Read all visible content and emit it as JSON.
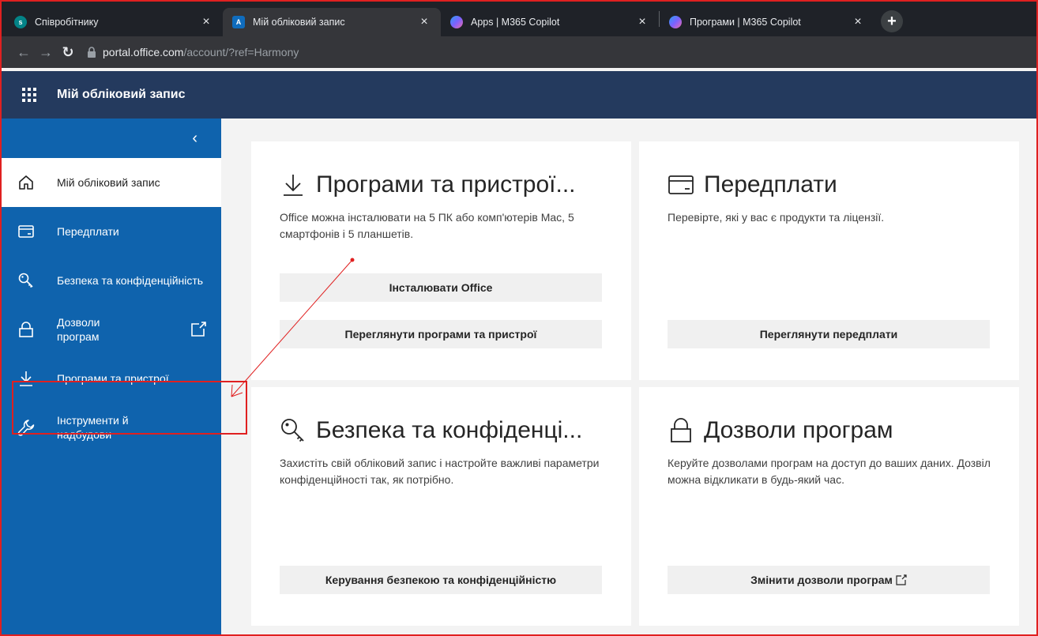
{
  "browser": {
    "tabs": [
      {
        "title": "Співробітнику",
        "favicon_color": "#038387",
        "favicon_text": "s",
        "active": false
      },
      {
        "title": "Мій обліковий запис",
        "favicon_color": "#0f6cbd",
        "favicon_text": "A",
        "active": true
      },
      {
        "title": "Apps | M365 Copilot",
        "favicon_color": "#7b61ff",
        "favicon_text": "",
        "active": false
      },
      {
        "title": "Програми | M365 Copilot",
        "favicon_color": "#7b61ff",
        "favicon_text": "",
        "active": false
      }
    ],
    "close_glyph": "×",
    "new_tab_glyph": "+",
    "url_host": "portal.office.com",
    "url_path": "/account/?ref=Harmony"
  },
  "app": {
    "title": "Мій обліковий запис"
  },
  "sidebar": {
    "collapse_glyph": "‹",
    "items": [
      {
        "label": "Мій обліковий запис",
        "icon": "home-icon",
        "selected": true
      },
      {
        "label": "Передплати",
        "icon": "card-icon",
        "selected": false
      },
      {
        "label": "Безпека та конфіденційність",
        "icon": "key-icon",
        "selected": false
      },
      {
        "label": "Дозволи програм",
        "icon": "lock-icon",
        "selected": false,
        "external": true
      },
      {
        "label": "Програми та пристрої",
        "icon": "download-icon",
        "selected": false
      },
      {
        "label": "Інструменти й надбудови",
        "icon": "wrench-icon",
        "selected": false
      }
    ]
  },
  "cards": {
    "apps": {
      "title": "Програми та пристрої...",
      "description": "Office можна інсталювати на 5 ПК або комп'ютерів Mac, 5 смартфонів і 5 планшетів.",
      "button1": "Інсталювати Office",
      "button2": "Переглянути програми та пристрої"
    },
    "subscriptions": {
      "title": "Передплати",
      "description": "Перевірте, які у вас є продукти та ліцензії.",
      "button": "Переглянути передплати"
    },
    "security": {
      "title": "Безпека та конфіденці...",
      "description": "Захистіть свій обліковий запис і настройте важливі параметри конфіденційності так, як потрібно.",
      "button": "Керування безпекою та конфіденційністю"
    },
    "permissions": {
      "title": "Дозволи програм",
      "description": "Керуйте дозволами програм на доступ до ваших даних. Дозвіл можна відкликати в будь-який час.",
      "button": "Змінити дозволи програм"
    }
  },
  "colors": {
    "sidebar": "#0f63ad",
    "header": "#243a5e",
    "annotation": "#e02020"
  }
}
